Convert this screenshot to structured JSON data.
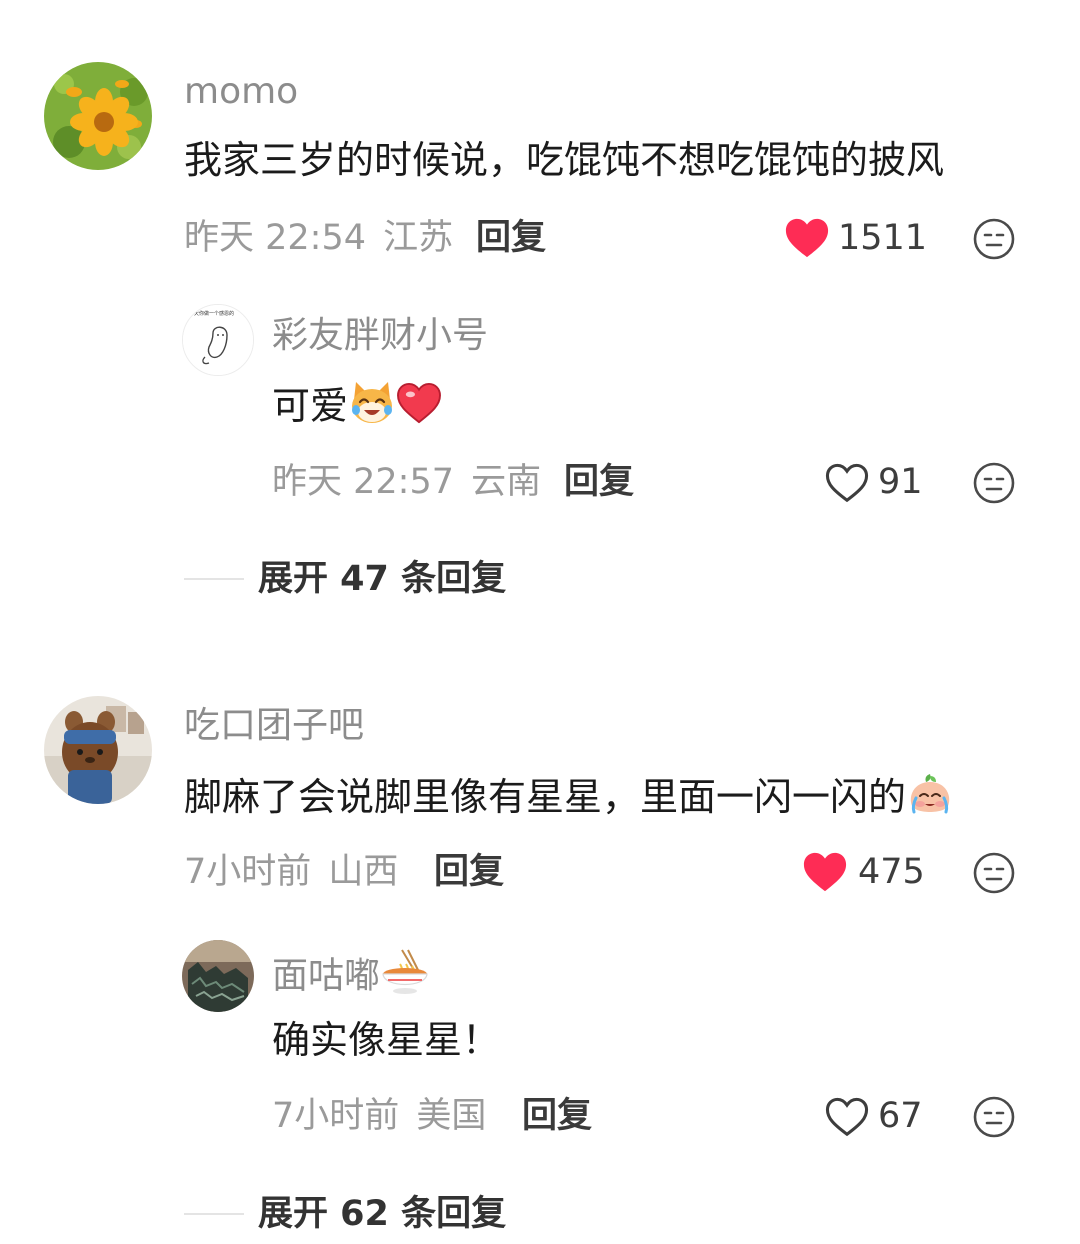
{
  "comments": [
    {
      "username": "momo",
      "text": "我家三岁的时候说，吃馄饨不想吃馄饨的披风",
      "time": "昨天 22:54",
      "location": "江苏",
      "reply_label": "回复",
      "likes": "1511",
      "liked": true,
      "replies": [
        {
          "username": "彩友胖财小号",
          "avatar_text": "今天你做一个感恩的",
          "text": "可爱",
          "time": "昨天 22:57",
          "location": "云南",
          "reply_label": "回复",
          "likes": "91",
          "liked": false
        }
      ],
      "expand_label": "展开 47 条回复"
    },
    {
      "username": "吃口团子吧",
      "text": "脚麻了会说脚里像有星星，里面一闪一闪的",
      "time": "7小时前",
      "location": "山西",
      "reply_label": "回复",
      "likes": "475",
      "liked": true,
      "replies": [
        {
          "username": "面咕嘟",
          "text": "确实像星星！",
          "time": "7小时前",
          "location": "美国",
          "reply_label": "回复",
          "likes": "67",
          "liked": false
        }
      ],
      "expand_label": "展开 62 条回复"
    }
  ],
  "colors": {
    "like_red": "#fe2c55",
    "meta_gray": "#9a9a9a"
  }
}
